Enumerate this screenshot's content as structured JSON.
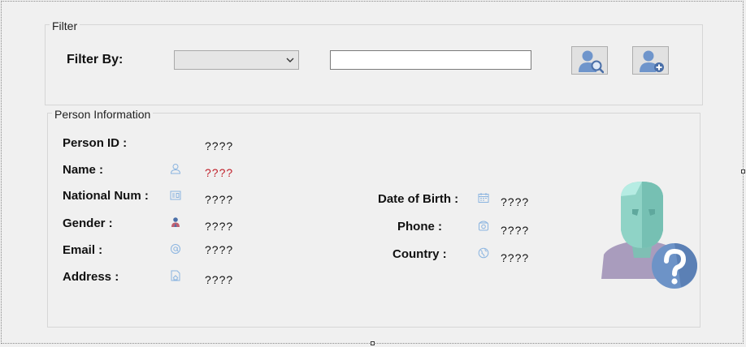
{
  "filter_group": {
    "legend": "Filter",
    "filter_by_label": "Filter By:",
    "filter_combo_value": "",
    "filter_text_value": ""
  },
  "buttons": {
    "find_person_icon": "find-person-icon",
    "add_person_icon": "add-person-icon"
  },
  "person_info": {
    "legend": "Person Information",
    "fields": {
      "person_id": {
        "label": "Person ID :",
        "value": "????"
      },
      "name": {
        "label": "Name :",
        "value": "????"
      },
      "national_num": {
        "label": "National Num :",
        "value": "????"
      },
      "gender": {
        "label": "Gender :",
        "value": "????"
      },
      "email": {
        "label": "Email :",
        "value": "????"
      },
      "address": {
        "label": "Address :",
        "value": "????"
      },
      "date_of_birth": {
        "label": "Date of Birth :",
        "value": "????"
      },
      "phone": {
        "label": "Phone :",
        "value": "????"
      },
      "country": {
        "label": "Country :",
        "value": "????"
      }
    },
    "name_value_color": "#c0202a",
    "icon_color": "#8ab4e0",
    "avatar_icon": "unknown-person-icon"
  }
}
